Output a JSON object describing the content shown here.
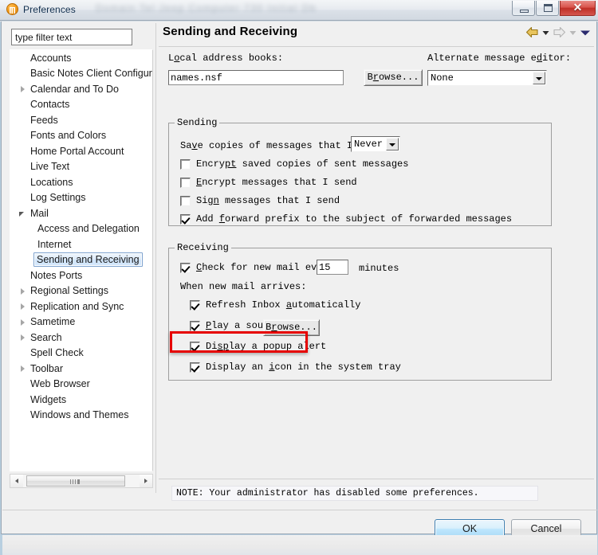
{
  "window": {
    "title": "Preferences",
    "icon": "preferences-app-icon",
    "blurred_caption": "Domain Tel Jeep Computer 730 Initial Db",
    "buttons": {
      "minimize": "minimize-icon",
      "maximize": "maximize-icon",
      "close": "✕"
    }
  },
  "sidebar": {
    "filter": {
      "value": "type filter text",
      "placeholder": "type filter text"
    },
    "items": [
      {
        "label": "Accounts",
        "level": 0,
        "twisty": "none"
      },
      {
        "label": "Basic Notes Client Configura",
        "level": 0,
        "twisty": "none"
      },
      {
        "label": "Calendar and To Do",
        "level": 0,
        "twisty": "collapsed"
      },
      {
        "label": "Contacts",
        "level": 0,
        "twisty": "none"
      },
      {
        "label": "Feeds",
        "level": 0,
        "twisty": "none"
      },
      {
        "label": "Fonts and Colors",
        "level": 0,
        "twisty": "none"
      },
      {
        "label": "Home Portal Account",
        "level": 0,
        "twisty": "none"
      },
      {
        "label": "Live Text",
        "level": 0,
        "twisty": "none"
      },
      {
        "label": "Locations",
        "level": 0,
        "twisty": "none"
      },
      {
        "label": "Log Settings",
        "level": 0,
        "twisty": "none"
      },
      {
        "label": "Mail",
        "level": 0,
        "twisty": "expanded"
      },
      {
        "label": "Access and Delegation",
        "level": 1,
        "twisty": "none"
      },
      {
        "label": "Internet",
        "level": 1,
        "twisty": "none"
      },
      {
        "label": "Sending and Receiving",
        "level": 1,
        "twisty": "none",
        "selected": true
      },
      {
        "label": "Notes Ports",
        "level": 0,
        "twisty": "none"
      },
      {
        "label": "Regional Settings",
        "level": 0,
        "twisty": "collapsed"
      },
      {
        "label": "Replication and Sync",
        "level": 0,
        "twisty": "collapsed"
      },
      {
        "label": "Sametime",
        "level": 0,
        "twisty": "collapsed"
      },
      {
        "label": "Search",
        "level": 0,
        "twisty": "collapsed"
      },
      {
        "label": "Spell Check",
        "level": 0,
        "twisty": "none"
      },
      {
        "label": "Toolbar",
        "level": 0,
        "twisty": "collapsed"
      },
      {
        "label": "Web Browser",
        "level": 0,
        "twisty": "none"
      },
      {
        "label": "Widgets",
        "level": 0,
        "twisty": "none"
      },
      {
        "label": "Windows and Themes",
        "level": 0,
        "twisty": "none"
      }
    ],
    "scrollbar": {
      "left_arrow": "scroll-left-icon",
      "right_arrow": "scroll-right-icon"
    }
  },
  "page": {
    "title": "Sending and Receiving",
    "nav": {
      "back": "back-arrow-icon",
      "back_menu": "back-dropdown-icon",
      "forward": "forward-arrow-icon",
      "forward_menu": "forward-dropdown-icon",
      "view_menu": "view-menu-chevron-icon"
    },
    "address_books": {
      "label_pre": "L",
      "label_mnemonic": "o",
      "label_post": "cal address books:",
      "value": "names.nsf",
      "browse_pre": "B",
      "browse_mnemonic": "r",
      "browse_post": "owse..."
    },
    "alt_editor": {
      "label_pre": "Alternate message e",
      "label_mnemonic": "d",
      "label_post": "itor:",
      "value": "None"
    },
    "sending": {
      "legend": "Sending",
      "save_copies": {
        "pre": "Sa",
        "mnemonic": "v",
        "post": "e copies of messages that I send:",
        "value": "Never"
      },
      "checkboxes": [
        {
          "pre": "Encry",
          "mnemonic": "pt",
          "post": " saved copies of sent messages",
          "checked": false
        },
        {
          "pre": "",
          "mnemonic": "E",
          "post": "ncrypt messages that I send",
          "checked": false
        },
        {
          "pre": "Si",
          "mnemonic": "gn",
          "post": " messages that I send",
          "checked": false
        },
        {
          "pre": "Add ",
          "mnemonic": "f",
          "post": "orward prefix to the subject of forwarded messages",
          "checked": true
        }
      ]
    },
    "receiving": {
      "legend": "Receiving",
      "check_mail": {
        "pre": "",
        "mnemonic": "C",
        "post": "heck for new mail every",
        "checked": true,
        "interval": "15",
        "unit": "minutes"
      },
      "arrives_label": "When new mail arrives:",
      "checkboxes": [
        {
          "pre": "Refresh Inbox ",
          "mnemonic": "a",
          "post": "utomatically",
          "checked": true,
          "highlighted": false
        },
        {
          "pre": "",
          "mnemonic": "P",
          "post": "lay a sound",
          "checked": true,
          "highlighted": false
        },
        {
          "pre": "Di",
          "mnemonic": "sp",
          "post": "lay a popup alert",
          "checked": true,
          "highlighted": true
        },
        {
          "pre": "Display an ",
          "mnemonic": "i",
          "post": "con in the system tray",
          "checked": true,
          "highlighted": false
        }
      ],
      "sound_browse": {
        "pre": "B",
        "mnemonic": "r",
        "post": "owse..."
      }
    }
  },
  "note": "NOTE: Your administrator has disabled some preferences.",
  "footer": {
    "ok": "OK",
    "cancel": "Cancel"
  },
  "colors": {
    "accent": "#3c7fb1",
    "highlight_red": "#e60000",
    "dialog_bg": "#f0f0f0",
    "close_btn": "#bf2f26",
    "back_arrow": "#c8a020"
  }
}
